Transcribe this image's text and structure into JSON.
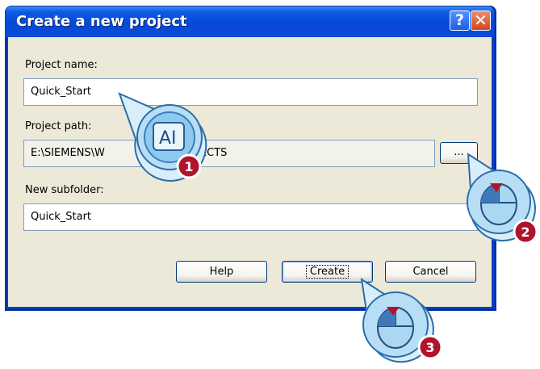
{
  "dialog": {
    "title": "Create a new project",
    "help_icon_glyph": "?",
    "close_icon_glyph": "✕"
  },
  "form": {
    "project_name_label": "Project name:",
    "project_name_value": "Quick_Start",
    "project_path_label": "Project path:",
    "project_path_value_left": "E:\\SIEMENS\\W",
    "project_path_value_right": "CPROJECTS",
    "browse_label": "...",
    "subfolder_label": "New subfolder:",
    "subfolder_value": "Quick_Start"
  },
  "buttons": {
    "help": "Help",
    "create": "Create",
    "cancel": "Cancel"
  },
  "callouts": [
    {
      "number": "1",
      "icon": "text-cursor-icon",
      "text": "AI"
    },
    {
      "number": "2",
      "icon": "mouse-click-icon"
    },
    {
      "number": "3",
      "icon": "mouse-click-icon"
    }
  ],
  "colors": {
    "title_bar": "#0549d8",
    "dialog_face": "#ece9d8",
    "callout_blue": "#9fd0f0",
    "badge_red": "#b0132b"
  }
}
